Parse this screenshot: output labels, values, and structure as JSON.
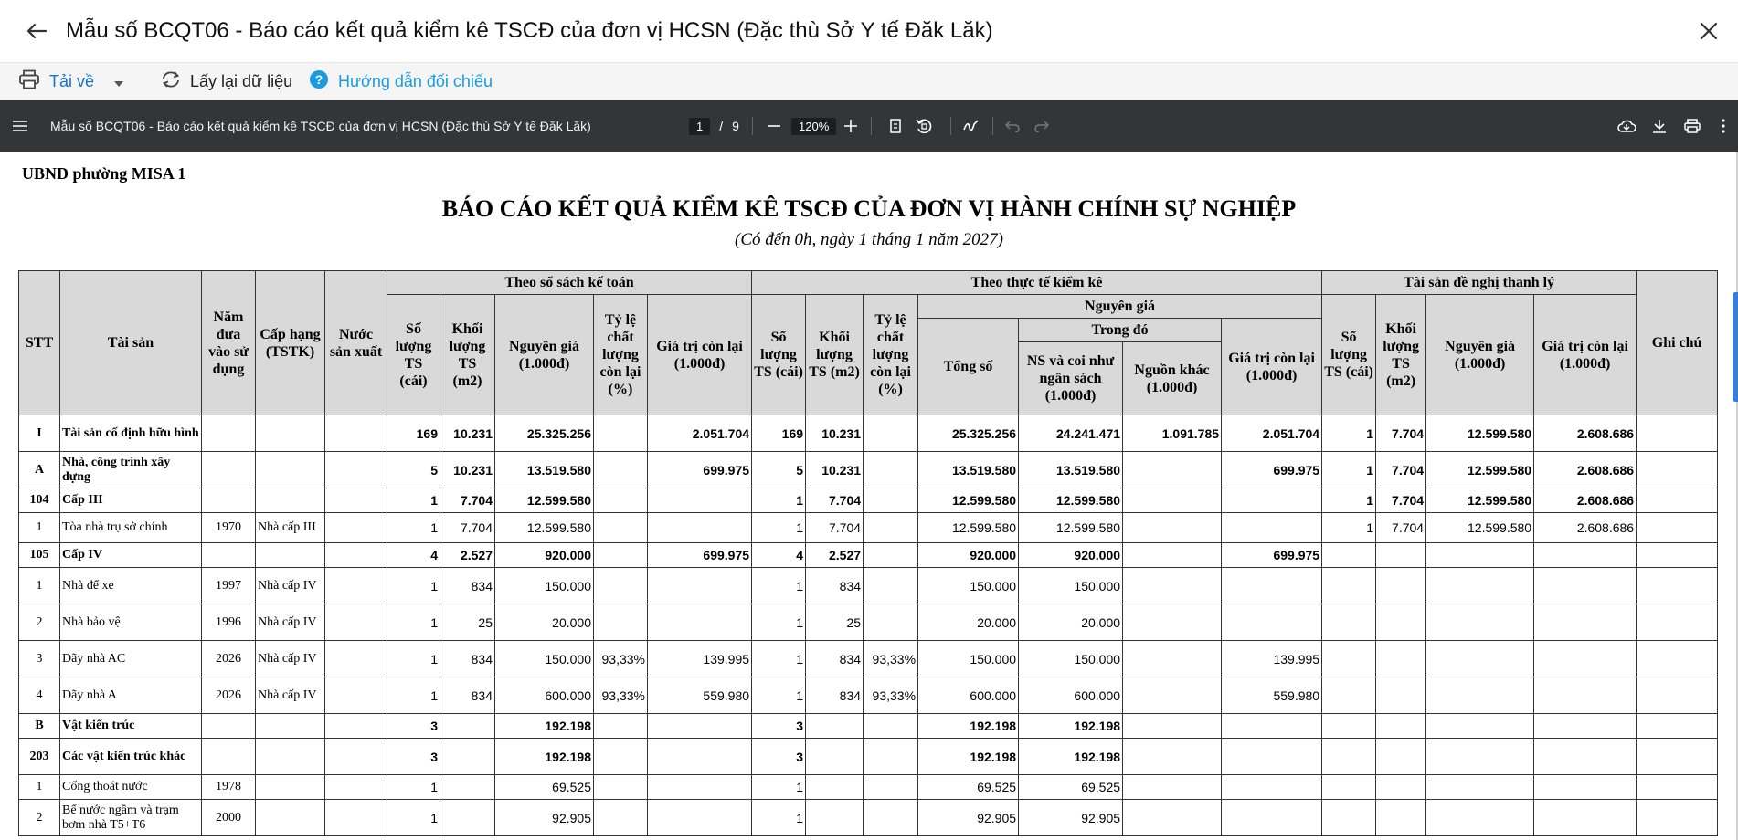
{
  "window": {
    "title": "Mẫu số BCQT06 - Báo cáo kết quả kiểm kê TSCĐ của đơn vị HCSN (Đặc thù Sở Y tế Đăk Lăk)"
  },
  "toolbar": {
    "download_label": "Tải về",
    "reload_label": "Lấy lại dữ liệu",
    "guide_label": "Hướng dẫn đối chiếu"
  },
  "viewer": {
    "doc_title": "Mẫu số BCQT06 - Báo cáo kết quả kiểm kê TSCĐ của đơn vị HCSN (Đặc thù Sở Y tế Đăk Lăk)",
    "current_page": "1",
    "page_sep": "/",
    "total_pages": "9",
    "zoom": "120%"
  },
  "report": {
    "org": "UBND phường MISA 1",
    "title": "BÁO CÁO KẾT QUẢ KIỂM KÊ TSCĐ CỦA ĐƠN VỊ HÀNH CHÍNH SỰ NGHIỆP",
    "subtitle": "(Có đến 0h, ngày 1 tháng 1 năm 2027)",
    "headers": {
      "stt": "STT",
      "asset": "Tài sản",
      "year": "Năm đưa vào sử dụng",
      "grade": "Cấp hạng (TSTK)",
      "country": "Nước sản xuất",
      "group_books": "Theo sổ sách kế toán",
      "group_actual": "Theo thực tế kiểm kê",
      "group_liq": "Tài sản đề nghị thanh lý",
      "qty": "Số lượng TS (cái)",
      "vol": "Khối lượng TS (m2)",
      "cost": "Nguyên giá (1.000đ)",
      "ratio": "Tỷ lệ chất lượng còn lại (%)",
      "remain": "Giá trị còn lại (1.000đ)",
      "orig_group": "Nguyên giá",
      "total": "Tổng số",
      "of_which": "Trong đó",
      "ns": "NS và coi như ngân sách (1.000đ)",
      "other": "Nguồn khác (1.000đ)",
      "note": "Ghi chú"
    },
    "rows": [
      {
        "bold": true,
        "stt": "I",
        "name": "Tài sản cố định hữu hình",
        "year": "",
        "grade": "",
        "country": "",
        "b_qty": "169",
        "b_vol": "10.231",
        "b_cost": "25.325.256",
        "b_ratio": "",
        "b_remain": "2.051.704",
        "a_qty": "169",
        "a_vol": "10.231",
        "a_ratio": "",
        "a_total": "25.325.256",
        "a_ns": "24.241.471",
        "a_other": "1.091.785",
        "a_remain": "2.051.704",
        "l_qty": "1",
        "l_vol": "7.704",
        "l_cost": "12.599.580",
        "l_remain": "2.608.686",
        "note": ""
      },
      {
        "bold": true,
        "stt": "A",
        "name": "Nhà, công trình xây dựng",
        "year": "",
        "grade": "",
        "country": "",
        "b_qty": "5",
        "b_vol": "10.231",
        "b_cost": "13.519.580",
        "b_ratio": "",
        "b_remain": "699.975",
        "a_qty": "5",
        "a_vol": "10.231",
        "a_ratio": "",
        "a_total": "13.519.580",
        "a_ns": "13.519.580",
        "a_other": "",
        "a_remain": "699.975",
        "l_qty": "1",
        "l_vol": "7.704",
        "l_cost": "12.599.580",
        "l_remain": "2.608.686",
        "note": ""
      },
      {
        "bold": true,
        "stt": "104",
        "name": "Cấp III",
        "year": "",
        "grade": "",
        "country": "",
        "b_qty": "1",
        "b_vol": "7.704",
        "b_cost": "12.599.580",
        "b_ratio": "",
        "b_remain": "",
        "a_qty": "1",
        "a_vol": "7.704",
        "a_ratio": "",
        "a_total": "12.599.580",
        "a_ns": "12.599.580",
        "a_other": "",
        "a_remain": "",
        "l_qty": "1",
        "l_vol": "7.704",
        "l_cost": "12.599.580",
        "l_remain": "2.608.686",
        "note": ""
      },
      {
        "bold": false,
        "stt": "1",
        "name": "Tòa nhà trụ sở chính",
        "year": "1970",
        "grade": "Nhà cấp III",
        "country": "",
        "b_qty": "1",
        "b_vol": "7.704",
        "b_cost": "12.599.580",
        "b_ratio": "",
        "b_remain": "",
        "a_qty": "1",
        "a_vol": "7.704",
        "a_ratio": "",
        "a_total": "12.599.580",
        "a_ns": "12.599.580",
        "a_other": "",
        "a_remain": "",
        "l_qty": "1",
        "l_vol": "7.704",
        "l_cost": "12.599.580",
        "l_remain": "2.608.686",
        "note": ""
      },
      {
        "bold": true,
        "stt": "105",
        "name": "Cấp IV",
        "year": "",
        "grade": "",
        "country": "",
        "b_qty": "4",
        "b_vol": "2.527",
        "b_cost": "920.000",
        "b_ratio": "",
        "b_remain": "699.975",
        "a_qty": "4",
        "a_vol": "2.527",
        "a_ratio": "",
        "a_total": "920.000",
        "a_ns": "920.000",
        "a_other": "",
        "a_remain": "699.975",
        "l_qty": "",
        "l_vol": "",
        "l_cost": "",
        "l_remain": "",
        "note": ""
      },
      {
        "bold": false,
        "stt": "1",
        "name": "Nhà để xe",
        "year": "1997",
        "grade": "Nhà cấp IV",
        "country": "",
        "b_qty": "1",
        "b_vol": "834",
        "b_cost": "150.000",
        "b_ratio": "",
        "b_remain": "",
        "a_qty": "1",
        "a_vol": "834",
        "a_ratio": "",
        "a_total": "150.000",
        "a_ns": "150.000",
        "a_other": "",
        "a_remain": "",
        "l_qty": "",
        "l_vol": "",
        "l_cost": "",
        "l_remain": "",
        "note": ""
      },
      {
        "bold": false,
        "stt": "2",
        "name": "Nhà bảo vệ",
        "year": "1996",
        "grade": "Nhà cấp IV",
        "country": "",
        "b_qty": "1",
        "b_vol": "25",
        "b_cost": "20.000",
        "b_ratio": "",
        "b_remain": "",
        "a_qty": "1",
        "a_vol": "25",
        "a_ratio": "",
        "a_total": "20.000",
        "a_ns": "20.000",
        "a_other": "",
        "a_remain": "",
        "l_qty": "",
        "l_vol": "",
        "l_cost": "",
        "l_remain": "",
        "note": ""
      },
      {
        "bold": false,
        "stt": "3",
        "name": "Dãy nhà AC",
        "year": "2026",
        "grade": "Nhà cấp IV",
        "country": "",
        "b_qty": "1",
        "b_vol": "834",
        "b_cost": "150.000",
        "b_ratio": "93,33%",
        "b_remain": "139.995",
        "a_qty": "1",
        "a_vol": "834",
        "a_ratio": "93,33%",
        "a_total": "150.000",
        "a_ns": "150.000",
        "a_other": "",
        "a_remain": "139.995",
        "l_qty": "",
        "l_vol": "",
        "l_cost": "",
        "l_remain": "",
        "note": ""
      },
      {
        "bold": false,
        "stt": "4",
        "name": "Dãy nhà A",
        "year": "2026",
        "grade": "Nhà cấp IV",
        "country": "",
        "b_qty": "1",
        "b_vol": "834",
        "b_cost": "600.000",
        "b_ratio": "93,33%",
        "b_remain": "559.980",
        "a_qty": "1",
        "a_vol": "834",
        "a_ratio": "93,33%",
        "a_total": "600.000",
        "a_ns": "600.000",
        "a_other": "",
        "a_remain": "559.980",
        "l_qty": "",
        "l_vol": "",
        "l_cost": "",
        "l_remain": "",
        "note": ""
      },
      {
        "bold": true,
        "stt": "B",
        "name": "Vật kiến trúc",
        "year": "",
        "grade": "",
        "country": "",
        "b_qty": "3",
        "b_vol": "",
        "b_cost": "192.198",
        "b_ratio": "",
        "b_remain": "",
        "a_qty": "3",
        "a_vol": "",
        "a_ratio": "",
        "a_total": "192.198",
        "a_ns": "192.198",
        "a_other": "",
        "a_remain": "",
        "l_qty": "",
        "l_vol": "",
        "l_cost": "",
        "l_remain": "",
        "note": ""
      },
      {
        "bold": true,
        "stt": "203",
        "name": "Các vật kiến trúc khác",
        "year": "",
        "grade": "",
        "country": "",
        "b_qty": "3",
        "b_vol": "",
        "b_cost": "192.198",
        "b_ratio": "",
        "b_remain": "",
        "a_qty": "3",
        "a_vol": "",
        "a_ratio": "",
        "a_total": "192.198",
        "a_ns": "192.198",
        "a_other": "",
        "a_remain": "",
        "l_qty": "",
        "l_vol": "",
        "l_cost": "",
        "l_remain": "",
        "note": ""
      },
      {
        "bold": false,
        "stt": "1",
        "name": "Cống thoát nước",
        "year": "1978",
        "grade": "",
        "country": "",
        "b_qty": "1",
        "b_vol": "",
        "b_cost": "69.525",
        "b_ratio": "",
        "b_remain": "",
        "a_qty": "1",
        "a_vol": "",
        "a_ratio": "",
        "a_total": "69.525",
        "a_ns": "69.525",
        "a_other": "",
        "a_remain": "",
        "l_qty": "",
        "l_vol": "",
        "l_cost": "",
        "l_remain": "",
        "note": ""
      },
      {
        "bold": false,
        "stt": "2",
        "name": "Bể nước ngầm và trạm bơm nhà T5+T6",
        "year": "2000",
        "grade": "",
        "country": "",
        "b_qty": "1",
        "b_vol": "",
        "b_cost": "92.905",
        "b_ratio": "",
        "b_remain": "",
        "a_qty": "1",
        "a_vol": "",
        "a_ratio": "",
        "a_total": "92.905",
        "a_ns": "92.905",
        "a_other": "",
        "a_remain": "",
        "l_qty": "",
        "l_vol": "",
        "l_cost": "",
        "l_remain": "",
        "note": ""
      }
    ]
  }
}
